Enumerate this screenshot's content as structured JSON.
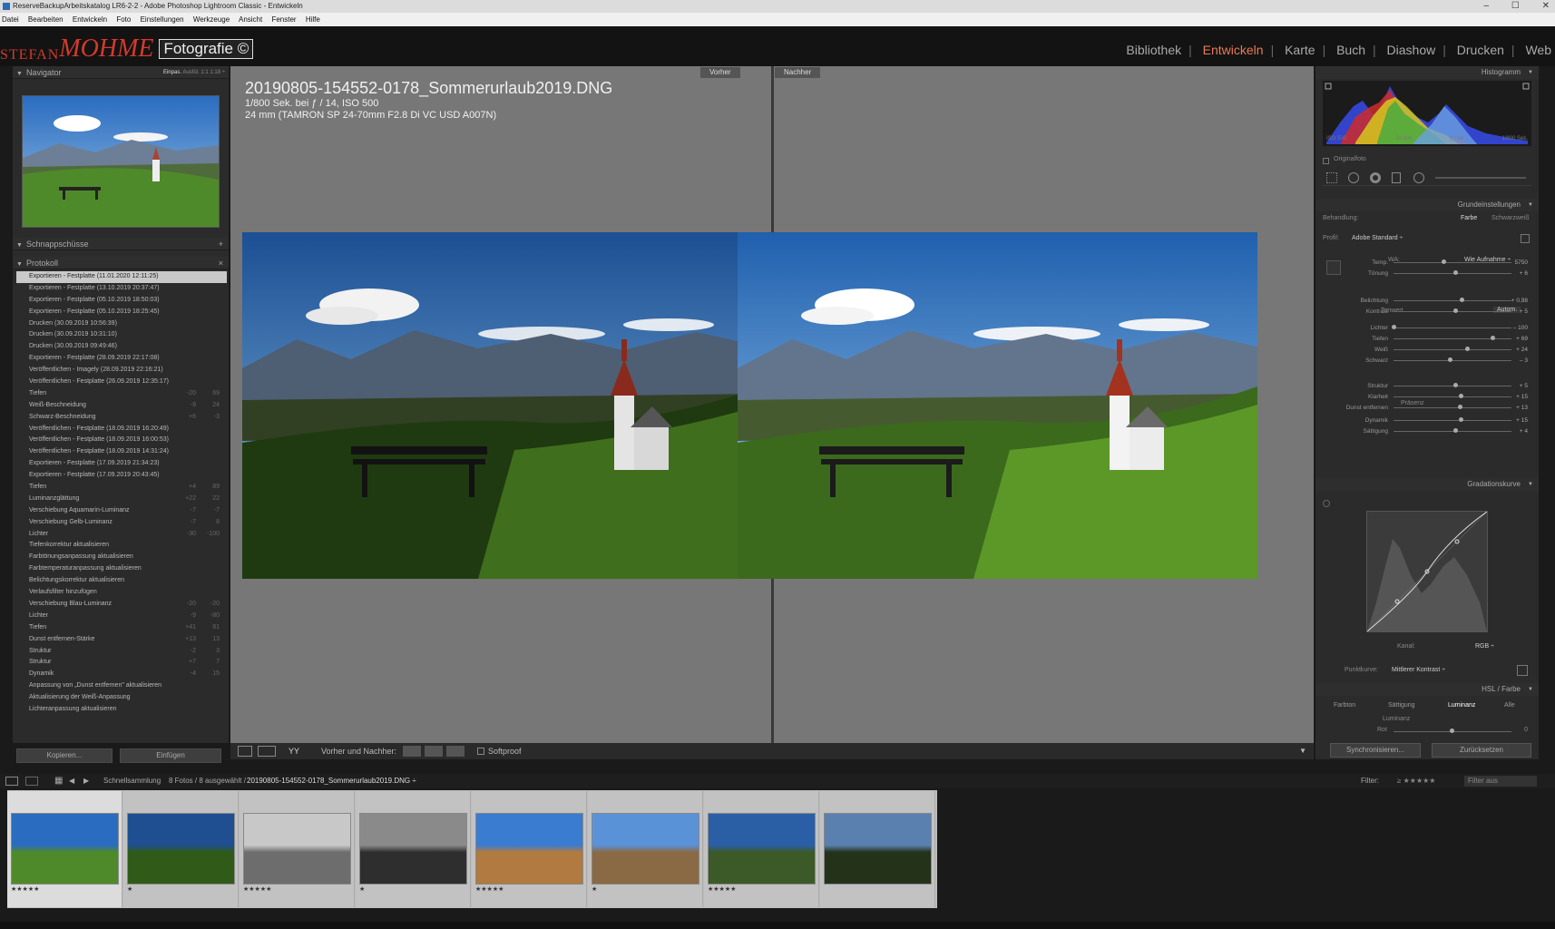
{
  "window": {
    "title": "ReserveBackupArbeitskatalog LR6-2-2 - Adobe Photoshop Lightroom Classic - Entwickeln",
    "controls": [
      "–",
      "☐",
      "✕"
    ]
  },
  "menu": [
    "Datei",
    "Bearbeiten",
    "Entwickeln",
    "Foto",
    "Einstellungen",
    "Werkzeuge",
    "Ansicht",
    "Fenster",
    "Hilfe"
  ],
  "logo": {
    "part1": "STEFAN",
    "part2": "MOHME",
    "part3": "Fotografie ©"
  },
  "modules": [
    "Bibliothek",
    "Entwickeln",
    "Karte",
    "Buch",
    "Diashow",
    "Drucken",
    "Web"
  ],
  "active_module": "Entwickeln",
  "left": {
    "navigator": {
      "label": "Navigator",
      "options": [
        "Einpas.",
        "Ausfül.",
        "1:1",
        "1:18 ÷"
      ]
    },
    "snapshots": {
      "label": "Schnappschüsse",
      "add": "+"
    },
    "history": {
      "label": "Protokoll",
      "close": "×",
      "items": [
        {
          "t": "Exportieren - Festplatte (11.01.2020 12:11:25)",
          "a": "",
          "b": ""
        },
        {
          "t": "Exportieren - Festplatte (13.10.2019 20:37:47)",
          "a": "",
          "b": ""
        },
        {
          "t": "Exportieren - Festplatte (05.10.2019 18:50:03)",
          "a": "",
          "b": ""
        },
        {
          "t": "Exportieren - Festplatte (05.10.2019 18:25:45)",
          "a": "",
          "b": ""
        },
        {
          "t": "Drucken (30.09.2019 10:56:39)",
          "a": "",
          "b": ""
        },
        {
          "t": "Drucken (30.09.2019 10:31:10)",
          "a": "",
          "b": ""
        },
        {
          "t": "Drucken (30.09.2019 09:49:46)",
          "a": "",
          "b": ""
        },
        {
          "t": "Exportieren - Festplatte (28.09.2019 22:17:08)",
          "a": "",
          "b": ""
        },
        {
          "t": "Veröffentlichen - Imagely (28.09.2019 22:16:21)",
          "a": "",
          "b": ""
        },
        {
          "t": "Veröffentlichen - Festplatte (26.09.2019 12:35:17)",
          "a": "",
          "b": ""
        },
        {
          "t": "Tiefen",
          "a": "-20",
          "b": "69"
        },
        {
          "t": "Weiß-Beschneidung",
          "a": "-9",
          "b": "24"
        },
        {
          "t": "Schwarz-Beschneidung",
          "a": "+6",
          "b": "-3"
        },
        {
          "t": "Veröffentlichen - Festplatte (18.09.2019 16:20:49)",
          "a": "",
          "b": ""
        },
        {
          "t": "Veröffentlichen - Festplatte (18.09.2019 16:00:53)",
          "a": "",
          "b": ""
        },
        {
          "t": "Veröffentlichen - Festplatte (18.09.2019 14:31:24)",
          "a": "",
          "b": ""
        },
        {
          "t": "Exportieren - Festplatte (17.09.2019 21:34:23)",
          "a": "",
          "b": ""
        },
        {
          "t": "Exportieren - Festplatte (17.09.2019 20:43:45)",
          "a": "",
          "b": ""
        },
        {
          "t": "Tiefen",
          "a": "+4",
          "b": "89"
        },
        {
          "t": "Luminanzglättung",
          "a": "+22",
          "b": "22"
        },
        {
          "t": "Verschiebung Aquamarin-Luminanz",
          "a": "-7",
          "b": "-7"
        },
        {
          "t": "Verschiebung Gelb-Luminanz",
          "a": "-7",
          "b": "8"
        },
        {
          "t": "Lichter",
          "a": "-30",
          "b": "-100"
        },
        {
          "t": "Tiefenkorrektur aktualisieren",
          "a": "",
          "b": ""
        },
        {
          "t": "Farbtönungsanpassung aktualisieren",
          "a": "",
          "b": ""
        },
        {
          "t": "Farbtemperaturanpassung aktualisieren",
          "a": "",
          "b": ""
        },
        {
          "t": "Belichtungskorrektur aktualisieren",
          "a": "",
          "b": ""
        },
        {
          "t": "Verlaufsfilter hinzufügen",
          "a": "",
          "b": ""
        },
        {
          "t": "Verschiebung Blau-Luminanz",
          "a": "-20",
          "b": "-20"
        },
        {
          "t": "Lichter",
          "a": "-9",
          "b": "-80"
        },
        {
          "t": "Tiefen",
          "a": "+41",
          "b": "81"
        },
        {
          "t": "Dunst entfernen-Stärke",
          "a": "+13",
          "b": "13"
        },
        {
          "t": "Struktur",
          "a": "-2",
          "b": "3"
        },
        {
          "t": "Struktur",
          "a": "+7",
          "b": "7"
        },
        {
          "t": "Dynamik",
          "a": "-4",
          "b": "15"
        },
        {
          "t": "Anpassung von „Dunst entfernen\" aktualisieren",
          "a": "",
          "b": ""
        },
        {
          "t": "Aktualisierung der Weiß-Anpassung",
          "a": "",
          "b": ""
        },
        {
          "t": "Lichteranpassung aktualisieren",
          "a": "",
          "b": ""
        }
      ]
    },
    "copy_btn": "Kopieren...",
    "paste_btn": "Einfügen"
  },
  "center": {
    "before_label": "Vorher",
    "after_label": "Nachher",
    "filename": "20190805-154552-0178_Sommerurlaub2019.DNG",
    "exif1": "1/800 Sek. bei ƒ / 14, ISO 500",
    "exif2": "24 mm (TAMRON SP 24-70mm F2.8 Di VC USD A007N)"
  },
  "toolbar": {
    "view1": "YY",
    "label": "Vorher und Nachher:",
    "softproof": "Softproof"
  },
  "right": {
    "histogram": {
      "label": "Histogramm",
      "iso": "ISO 500",
      "focal": "24 mm",
      "aperture": "ƒ / 14",
      "shutter": "1/800 Sek.",
      "original": "Originalfoto"
    },
    "basic": {
      "label": "Grundeinstellungen",
      "treatment": "Behandlung:",
      "color": "Farbe",
      "bw": "Schwarzweiß",
      "profile_label": "Profil:",
      "profile": "Adobe Standard ÷",
      "wb_label": "WA:",
      "wb": "Wie Aufnahme ÷",
      "tone_label": "Tonwert",
      "auto": "Autom.",
      "presence": "Präsenz"
    },
    "sliders": [
      {
        "l": "Temp.",
        "v": "5750",
        "p": 0.42
      },
      {
        "l": "Tönung",
        "v": "+ 6",
        "p": 0.52
      },
      {
        "l": "Belichtung",
        "v": "+ 0,98",
        "p": 0.58
      },
      {
        "l": "Kontrast",
        "v": "+ 5",
        "p": 0.52
      },
      {
        "l": "Lichter",
        "v": "– 100",
        "p": 0.0
      },
      {
        "l": "Tiefen",
        "v": "+ 69",
        "p": 0.84
      },
      {
        "l": "Weiß",
        "v": "+ 24",
        "p": 0.62
      },
      {
        "l": "Schwarz",
        "v": "– 3",
        "p": 0.48
      },
      {
        "l": "Struktur",
        "v": "+ 5",
        "p": 0.52
      },
      {
        "l": "Klarheit",
        "v": "+ 15",
        "p": 0.57
      },
      {
        "l": "Dunst entfernen",
        "v": "+ 13",
        "p": 0.56
      },
      {
        "l": "Dynamik",
        "v": "+ 15",
        "p": 0.57
      },
      {
        "l": "Sättigung",
        "v": "+ 4",
        "p": 0.52
      }
    ],
    "curve": {
      "label": "Gradationskurve",
      "channel_label": "Kanal:",
      "channel": "RGB ÷",
      "point_label": "Punktkurve:",
      "point": "Mittlerer Kontrast ÷"
    },
    "hsl": {
      "label": "HSL / Farbe",
      "tabs": [
        "Farbton",
        "Sättigung",
        "Luminanz",
        "Alle"
      ],
      "active_tab": "Luminanz",
      "sub": "Luminanz",
      "row": "Rot",
      "row_val": "0"
    },
    "sync_btn": "Synchronisieren...",
    "reset_btn": "Zurücksetzen"
  },
  "filmbar": {
    "source": "Schnellsammlung",
    "count": "8 Fotos / 8 ausgewählt /",
    "file": "20190805-154552-0178_Sommerurlaub2019.DNG ÷",
    "filter_label": "Filter:",
    "filter": "Filter aus"
  },
  "film": [
    {
      "stars": "★★★★★",
      "scene": "church"
    },
    {
      "stars": "★",
      "scene": "church2"
    },
    {
      "stars": "★★★★★",
      "scene": "posts"
    },
    {
      "stars": "★",
      "scene": "posts2"
    },
    {
      "stars": "★★★★★",
      "scene": "field"
    },
    {
      "stars": "★",
      "scene": "field2"
    },
    {
      "stars": "★★★★★",
      "scene": "trees"
    },
    {
      "stars": "",
      "scene": "trees2"
    }
  ]
}
